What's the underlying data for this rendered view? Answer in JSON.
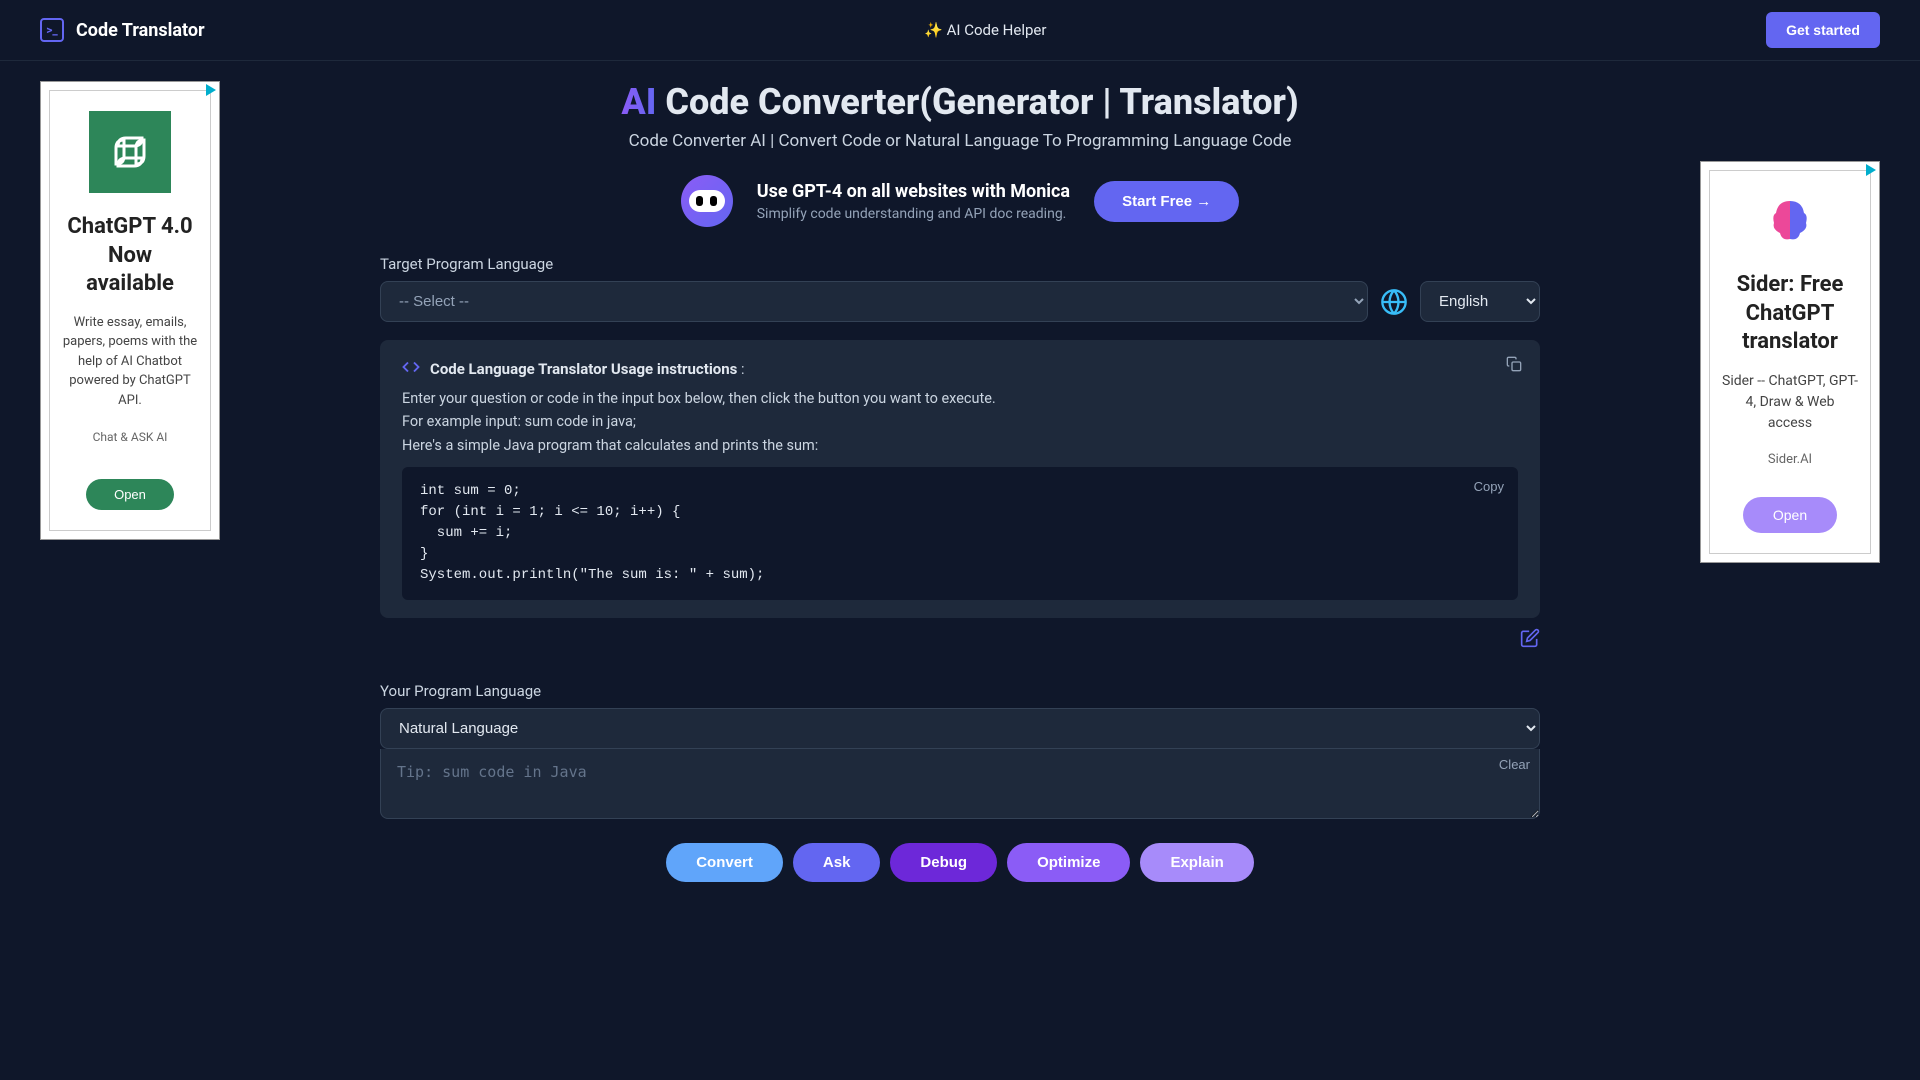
{
  "header": {
    "logo_text": "Code Translator",
    "center": "✨ AI Code Helper",
    "get_started": "Get started"
  },
  "hero": {
    "ai_prefix": "AI",
    "headline_rest": " Code Converter(Generator | Translator)",
    "subhead": "Code Converter AI | Convert Code or Natural Language To Programming Language Code"
  },
  "promo": {
    "title": "Use GPT-4 on all websites with Monica",
    "sub": "Simplify code understanding and API doc reading.",
    "cta": "Start Free →"
  },
  "target": {
    "label": "Target Program Language",
    "placeholder": "-- Select --",
    "interface_lang": "English"
  },
  "instructions": {
    "title": "Code Language Translator Usage instructions",
    "colon": " :",
    "line1": "Enter your question or code in the input box below, then click the button you want to execute.",
    "line2": "For example input: sum code in java;",
    "line3": "Here's a simple Java program that calculates and prints the sum:",
    "code": "int sum = 0;\nfor (int i = 1; i <= 10; i++) {\n  sum += i;\n}\nSystem.out.println(\"The sum is: \" + sum);",
    "copy_label": "Copy"
  },
  "input": {
    "label": "Your Program Language",
    "selected_lang": "Natural Language",
    "placeholder": "Tip: sum code in Java",
    "clear": "Clear"
  },
  "actions": {
    "convert": "Convert",
    "ask": "Ask",
    "debug": "Debug",
    "optimize": "Optimize",
    "explain": "Explain"
  },
  "ad_left": {
    "title": "ChatGPT 4.0 Now available",
    "body": "Write essay, emails, papers, poems with the help of AI Chatbot powered by ChatGPT API.",
    "sub": "Chat & ASK AI",
    "open": "Open"
  },
  "ad_right": {
    "title": "Sider: Free ChatGPT translator",
    "body": "Sider -- ChatGPT, GPT-4, Draw & Web access",
    "sub": "Sider.AI",
    "open": "Open"
  }
}
